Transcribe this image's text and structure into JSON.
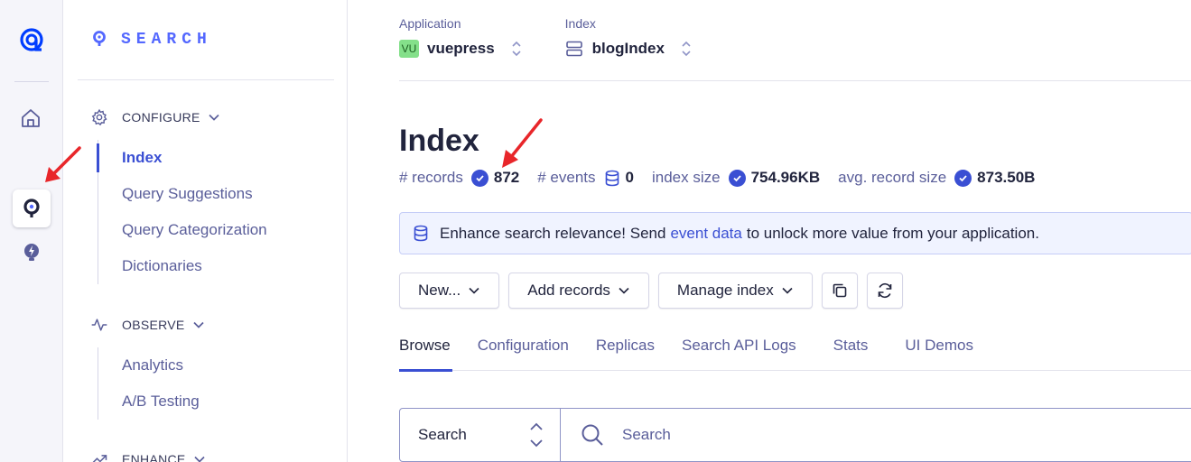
{
  "rail": {
    "items": [
      "home-icon",
      "search-product-icon",
      "recommend-bulb-icon"
    ]
  },
  "sidebar": {
    "brand": "SEARCH",
    "configure": {
      "label": "CONFIGURE",
      "items": [
        {
          "label": "Index",
          "active": true
        },
        {
          "label": "Query Suggestions"
        },
        {
          "label": "Query Categorization"
        },
        {
          "label": "Dictionaries"
        }
      ]
    },
    "observe": {
      "label": "OBSERVE",
      "items": [
        {
          "label": "Analytics"
        },
        {
          "label": "A/B Testing"
        }
      ]
    },
    "enhance": {
      "label": "ENHANCE"
    }
  },
  "header": {
    "application_label": "Application",
    "application_badge": "VU",
    "application_value": "vuepress",
    "index_label": "Index",
    "index_value": "blogIndex"
  },
  "main": {
    "title": "Index",
    "stats": {
      "records_label": "# records",
      "records_value": "872",
      "events_label": "# events",
      "events_value": "0",
      "size_label": "index size",
      "size_value": "754.96KB",
      "avg_label": "avg. record size",
      "avg_value": "873.50B"
    },
    "banner": {
      "text_before": "Enhance search relevance! Send",
      "link": "event data",
      "text_after": "to unlock more value from your application."
    },
    "toolbar": {
      "new": "New...",
      "add_records": "Add records",
      "manage_index": "Manage index"
    },
    "tabs": [
      "Browse",
      "Configuration",
      "Replicas",
      "Search API Logs",
      "Stats",
      "UI Demos"
    ],
    "search": {
      "type_value": "Search",
      "placeholder": "Search"
    }
  },
  "colors": {
    "accent": "#3a4fd3",
    "brand": "#5468ff",
    "annotation_arrow": "#e8262a",
    "badge_green": "#84e08a"
  }
}
